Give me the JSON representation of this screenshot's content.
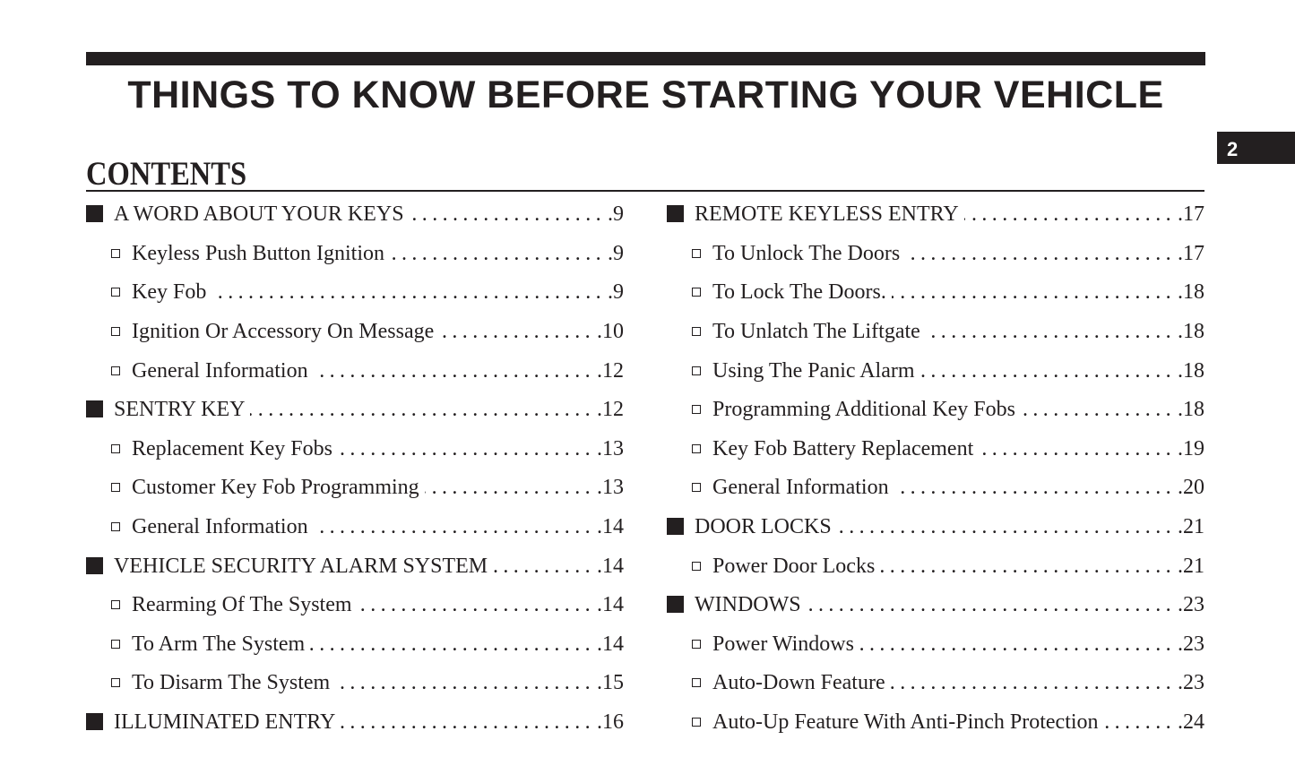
{
  "chapter": {
    "title": "THINGS TO KNOW BEFORE STARTING YOUR VEHICLE",
    "number": "2"
  },
  "contents": {
    "heading": "CONTENTS",
    "leader": "..............................................................................",
    "left_column": [
      {
        "level": "main",
        "title": "A WORD ABOUT YOUR KEYS",
        "page": ".9"
      },
      {
        "level": "sub",
        "title": "Keyless Push Button Ignition",
        "page": ".9"
      },
      {
        "level": "sub",
        "title": "Key Fob",
        "page": ".9"
      },
      {
        "level": "sub",
        "title": "Ignition Or Accessory On Message",
        "page": ".10"
      },
      {
        "level": "sub",
        "title": "General Information",
        "page": ".12"
      },
      {
        "level": "main",
        "title": "SENTRY KEY",
        "page": ".12"
      },
      {
        "level": "sub",
        "title": "Replacement Key Fobs",
        "page": ".13"
      },
      {
        "level": "sub",
        "title": "Customer Key Fob Programming",
        "page": ".13"
      },
      {
        "level": "sub",
        "title": "General Information",
        "page": ".14"
      },
      {
        "level": "main",
        "title": "VEHICLE SECURITY ALARM SYSTEM",
        "page": ".14"
      },
      {
        "level": "sub",
        "title": "Rearming Of The System",
        "page": ".14"
      },
      {
        "level": "sub",
        "title": "To Arm The System",
        "page": ".14"
      },
      {
        "level": "sub",
        "title": "To Disarm The System",
        "page": ".15"
      },
      {
        "level": "main",
        "title": "ILLUMINATED ENTRY",
        "page": ".16"
      }
    ],
    "right_column": [
      {
        "level": "main",
        "title": "REMOTE KEYLESS ENTRY",
        "page": ".17"
      },
      {
        "level": "sub",
        "title": "To Unlock The Doors",
        "page": ".17"
      },
      {
        "level": "sub",
        "title": "To Lock The Doors.",
        "page": ".18"
      },
      {
        "level": "sub",
        "title": "To Unlatch The Liftgate",
        "page": ".18"
      },
      {
        "level": "sub",
        "title": "Using The Panic Alarm",
        "page": ".18"
      },
      {
        "level": "sub",
        "title": "Programming Additional Key Fobs",
        "page": ".18"
      },
      {
        "level": "sub",
        "title": "Key Fob Battery Replacement",
        "page": ".19"
      },
      {
        "level": "sub",
        "title": "General Information",
        "page": ".20"
      },
      {
        "level": "main",
        "title": "DOOR LOCKS",
        "page": ".21"
      },
      {
        "level": "sub",
        "title": "Power Door Locks",
        "page": ".21"
      },
      {
        "level": "main",
        "title": "WINDOWS",
        "page": ".23"
      },
      {
        "level": "sub",
        "title": "Power Windows",
        "page": ".23"
      },
      {
        "level": "sub",
        "title": "Auto-Down Feature",
        "page": ".23"
      },
      {
        "level": "sub",
        "title": "Auto-Up Feature With Anti-Pinch Protection",
        "page": ".24"
      }
    ]
  }
}
